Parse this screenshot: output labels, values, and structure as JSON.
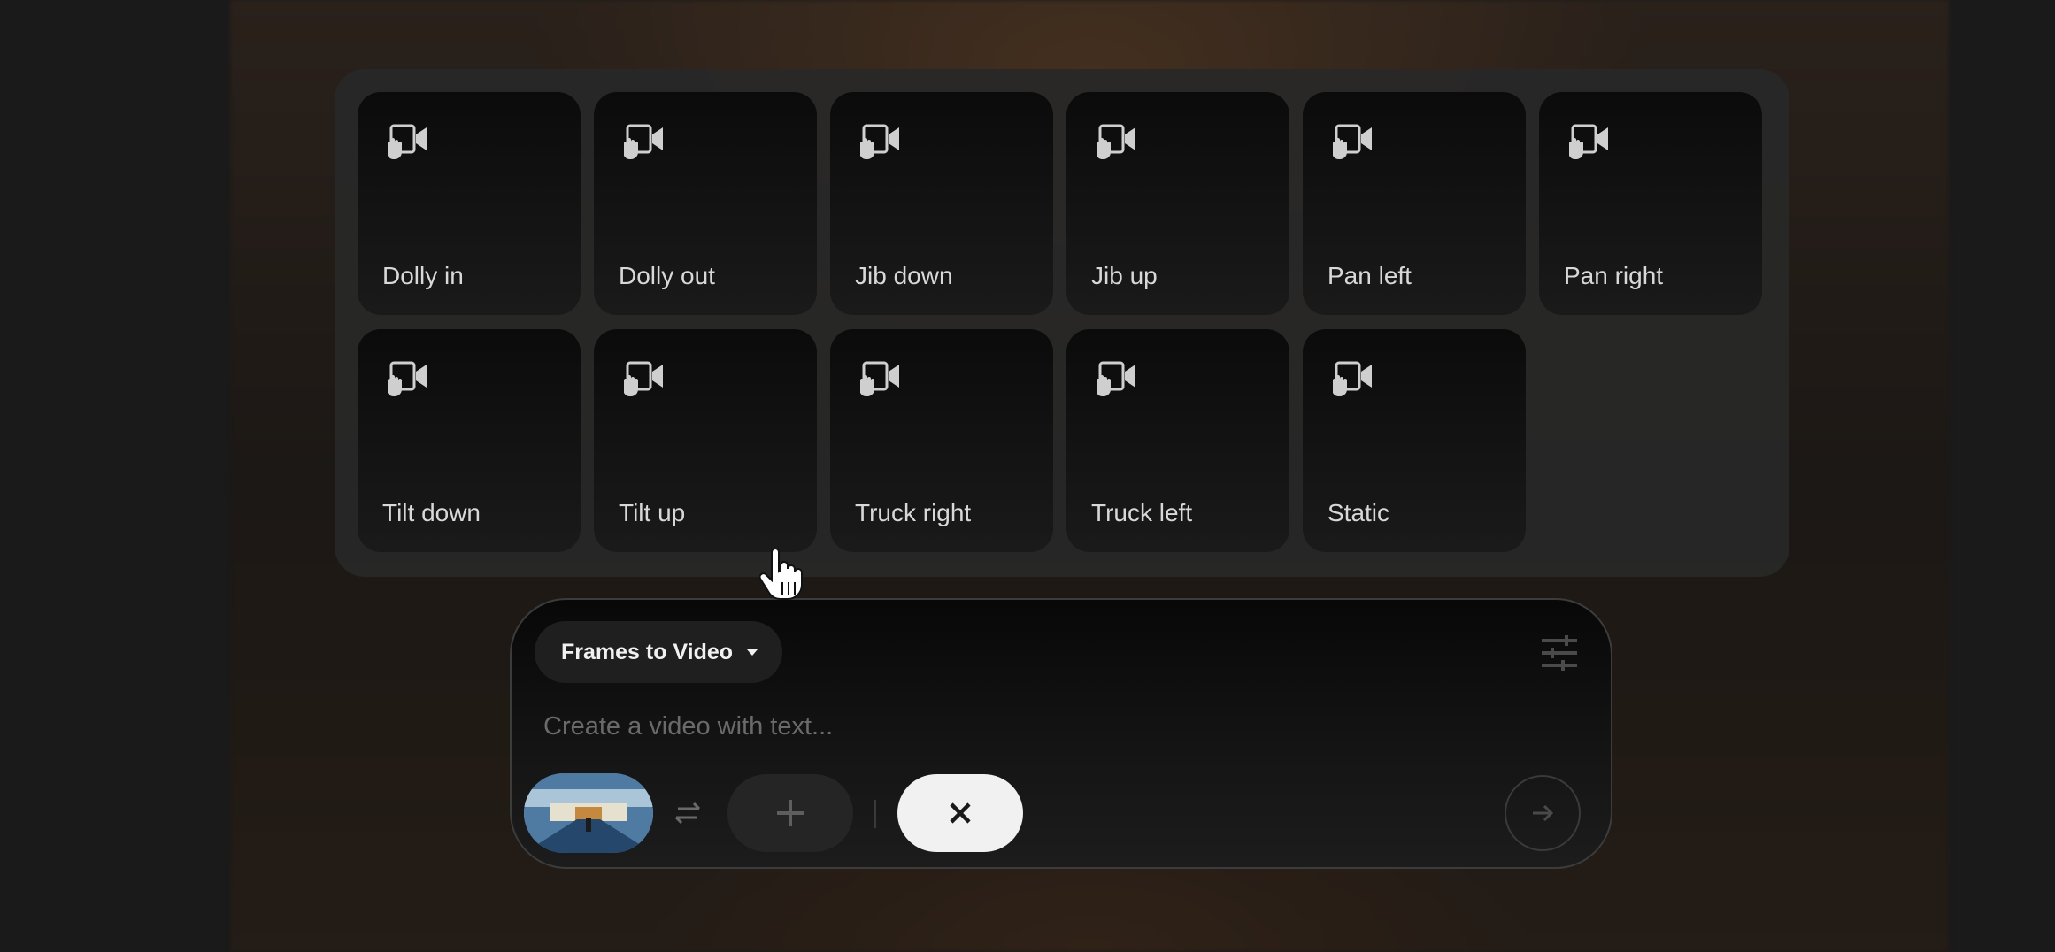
{
  "camera_motions": {
    "row1": [
      {
        "label": "Dolly in",
        "icon": "camera-motion-icon"
      },
      {
        "label": "Dolly out",
        "icon": "camera-motion-icon"
      },
      {
        "label": "Jib down",
        "icon": "camera-motion-icon"
      },
      {
        "label": "Jib up",
        "icon": "camera-motion-icon"
      },
      {
        "label": "Pan left",
        "icon": "camera-motion-icon"
      },
      {
        "label": "Pan right",
        "icon": "camera-motion-icon"
      }
    ],
    "row2": [
      {
        "label": "Tilt down",
        "icon": "camera-motion-icon"
      },
      {
        "label": "Tilt up",
        "icon": "camera-motion-icon"
      },
      {
        "label": "Truck right",
        "icon": "camera-motion-icon"
      },
      {
        "label": "Truck left",
        "icon": "camera-motion-icon"
      },
      {
        "label": "Static",
        "icon": "camera-motion-icon"
      }
    ]
  },
  "prompt": {
    "mode_label": "Frames to Video",
    "placeholder": "Create a video with text...",
    "value": "",
    "settings_icon": "sliders-icon",
    "swap_icon": "swap-icon",
    "add_icon": "plus-icon",
    "close_icon": "close-icon",
    "send_icon": "arrow-right-icon"
  },
  "colors": {
    "background": "#1a1a1a",
    "panel": "#282828",
    "card_label": "#d8d8d8",
    "close_button": "#f1f1f1"
  }
}
